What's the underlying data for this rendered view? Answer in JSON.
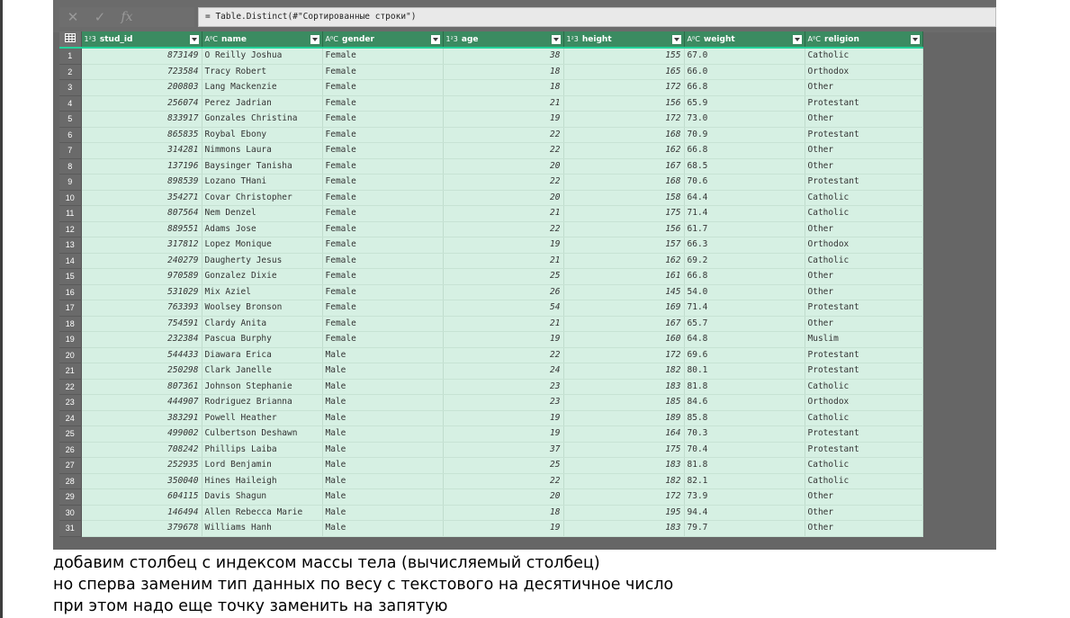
{
  "formula_bar": {
    "cancel_icon": "close-icon",
    "confirm_icon": "check-icon",
    "fx_icon": "fx-icon",
    "cancel_glyph": "✕",
    "confirm_glyph": "✓",
    "fx_glyph": "fx",
    "formula": "= Table.Distinct(#\"Сортированные строки\")"
  },
  "table": {
    "corner_icon": "table-icon",
    "columns": [
      {
        "key": "stud_id",
        "type_icon": "1²3",
        "label": "stud_id"
      },
      {
        "key": "name",
        "type_icon": "AᴮC",
        "label": "name"
      },
      {
        "key": "gender",
        "type_icon": "AᴮC",
        "label": "gender"
      },
      {
        "key": "age",
        "type_icon": "1²3",
        "label": "age"
      },
      {
        "key": "height",
        "type_icon": "1²3",
        "label": "height"
      },
      {
        "key": "weight",
        "type_icon": "AᴮC",
        "label": "weight"
      },
      {
        "key": "religion",
        "type_icon": "AᴮC",
        "label": "religion"
      }
    ],
    "rows": [
      [
        "1",
        "873149",
        "O Reilly Joshua",
        "Female",
        "38",
        "155",
        "67.0",
        "Catholic"
      ],
      [
        "2",
        "723584",
        "Tracy Robert",
        "Female",
        "18",
        "165",
        "66.0",
        "Orthodox"
      ],
      [
        "3",
        "200803",
        "Lang Mackenzie",
        "Female",
        "18",
        "172",
        "66.8",
        "Other"
      ],
      [
        "4",
        "256074",
        "Perez Jadrian",
        "Female",
        "21",
        "156",
        "65.9",
        "Protestant"
      ],
      [
        "5",
        "833917",
        "Gonzales Christina",
        "Female",
        "19",
        "172",
        "73.0",
        "Other"
      ],
      [
        "6",
        "865835",
        "Roybal Ebony",
        "Female",
        "22",
        "168",
        "70.9",
        "Protestant"
      ],
      [
        "7",
        "314281",
        "Nimmons Laura",
        "Female",
        "22",
        "162",
        "66.8",
        "Other"
      ],
      [
        "8",
        "137196",
        "Baysinger Tanisha",
        "Female",
        "20",
        "167",
        "68.5",
        "Other"
      ],
      [
        "9",
        "898539",
        "Lozano THani",
        "Female",
        "22",
        "168",
        "70.6",
        "Protestant"
      ],
      [
        "10",
        "354271",
        "Covar Christopher",
        "Female",
        "20",
        "158",
        "64.4",
        "Catholic"
      ],
      [
        "11",
        "807564",
        "Nem Denzel",
        "Female",
        "21",
        "175",
        "71.4",
        "Catholic"
      ],
      [
        "12",
        "889551",
        "Adams Jose",
        "Female",
        "22",
        "156",
        "61.7",
        "Other"
      ],
      [
        "13",
        "317812",
        "Lopez Monique",
        "Female",
        "19",
        "157",
        "66.3",
        "Orthodox"
      ],
      [
        "14",
        "240279",
        "Daugherty Jesus",
        "Female",
        "21",
        "162",
        "69.2",
        "Catholic"
      ],
      [
        "15",
        "970589",
        "Gonzalez Dixie",
        "Female",
        "25",
        "161",
        "66.8",
        "Other"
      ],
      [
        "16",
        "531029",
        "Mix Aziel",
        "Female",
        "26",
        "145",
        "54.0",
        "Other"
      ],
      [
        "17",
        "763393",
        "Woolsey Bronson",
        "Female",
        "54",
        "169",
        "71.4",
        "Protestant"
      ],
      [
        "18",
        "754591",
        "Clardy Anita",
        "Female",
        "21",
        "167",
        "65.7",
        "Other"
      ],
      [
        "19",
        "232384",
        "Pascua Burphy",
        "Female",
        "19",
        "160",
        "64.8",
        "Muslim"
      ],
      [
        "20",
        "544433",
        "Diawara Erica",
        "Male",
        "22",
        "172",
        "69.6",
        "Protestant"
      ],
      [
        "21",
        "250298",
        "Clark Janelle",
        "Male",
        "24",
        "182",
        "80.1",
        "Protestant"
      ],
      [
        "22",
        "807361",
        "Johnson Stephanie",
        "Male",
        "23",
        "183",
        "81.8",
        "Catholic"
      ],
      [
        "23",
        "444907",
        "Rodriguez Brianna",
        "Male",
        "23",
        "185",
        "84.6",
        "Orthodox"
      ],
      [
        "24",
        "383291",
        "Powell Heather",
        "Male",
        "19",
        "189",
        "85.8",
        "Catholic"
      ],
      [
        "25",
        "499002",
        "Culbertson Deshawn",
        "Male",
        "19",
        "164",
        "70.3",
        "Protestant"
      ],
      [
        "26",
        "708242",
        "Phillips Laiba",
        "Male",
        "37",
        "175",
        "70.4",
        "Protestant"
      ],
      [
        "27",
        "252935",
        "Lord Benjamin",
        "Male",
        "25",
        "183",
        "81.8",
        "Catholic"
      ],
      [
        "28",
        "350040",
        "Hines Haileigh",
        "Male",
        "22",
        "182",
        "82.1",
        "Catholic"
      ],
      [
        "29",
        "604115",
        "Davis Shagun",
        "Male",
        "20",
        "172",
        "73.9",
        "Other"
      ],
      [
        "30",
        "146494",
        "Allen Rebecca Marie",
        "Male",
        "18",
        "195",
        "94.4",
        "Other"
      ],
      [
        "31",
        "379678",
        "Williams Hanh",
        "Male",
        "19",
        "183",
        "79.7",
        "Other"
      ]
    ]
  },
  "caption": {
    "line1": "добавим столбец с индексом массы тела (вычисляемый столбец)",
    "line2": "но сперва заменим тип данных по весу с текстового на десятичное число",
    "line3": "при этом надо еще точку заменить на запятую"
  },
  "colors": {
    "header_bg": "#3b8b61",
    "cell_bg": "#d6f0e3",
    "rownum_bg": "#6a6a6a",
    "panel_bg": "#666666"
  }
}
